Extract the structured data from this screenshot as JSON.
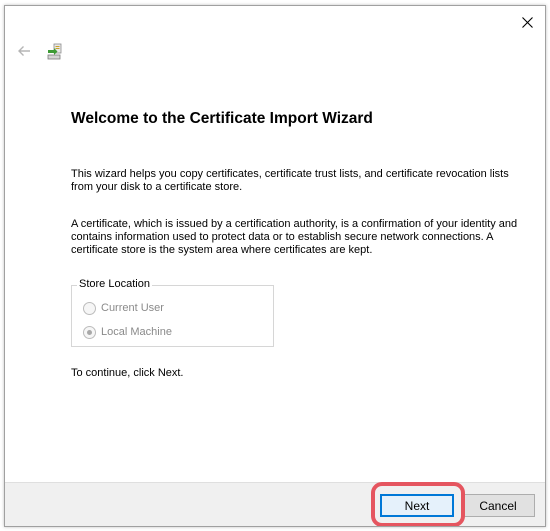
{
  "window": {
    "close_label": "✕"
  },
  "nav": {
    "back_icon": "back-arrow-icon",
    "wizard_icon": "certificate-wizard-icon"
  },
  "wizard": {
    "title": "Welcome to the Certificate Import Wizard",
    "paragraph1": "This wizard helps you copy certificates, certificate trust lists, and certificate revocation lists from your disk to a certificate store.",
    "paragraph2": "A certificate, which is issued by a certification authority, is a confirmation of your identity and contains information used to protect data or to establish secure network connections. A certificate store is the system area where certificates are kept.",
    "store_location": {
      "label": "Store Location",
      "options": [
        {
          "label": "Current User",
          "checked": false,
          "enabled": false
        },
        {
          "label": "Local Machine",
          "checked": true,
          "enabled": false
        }
      ]
    },
    "continue_text": "To continue, click Next."
  },
  "footer": {
    "next_label": "Next",
    "cancel_label": "Cancel"
  },
  "colors": {
    "accent": "#0078d7",
    "highlight": "#e5555f"
  }
}
